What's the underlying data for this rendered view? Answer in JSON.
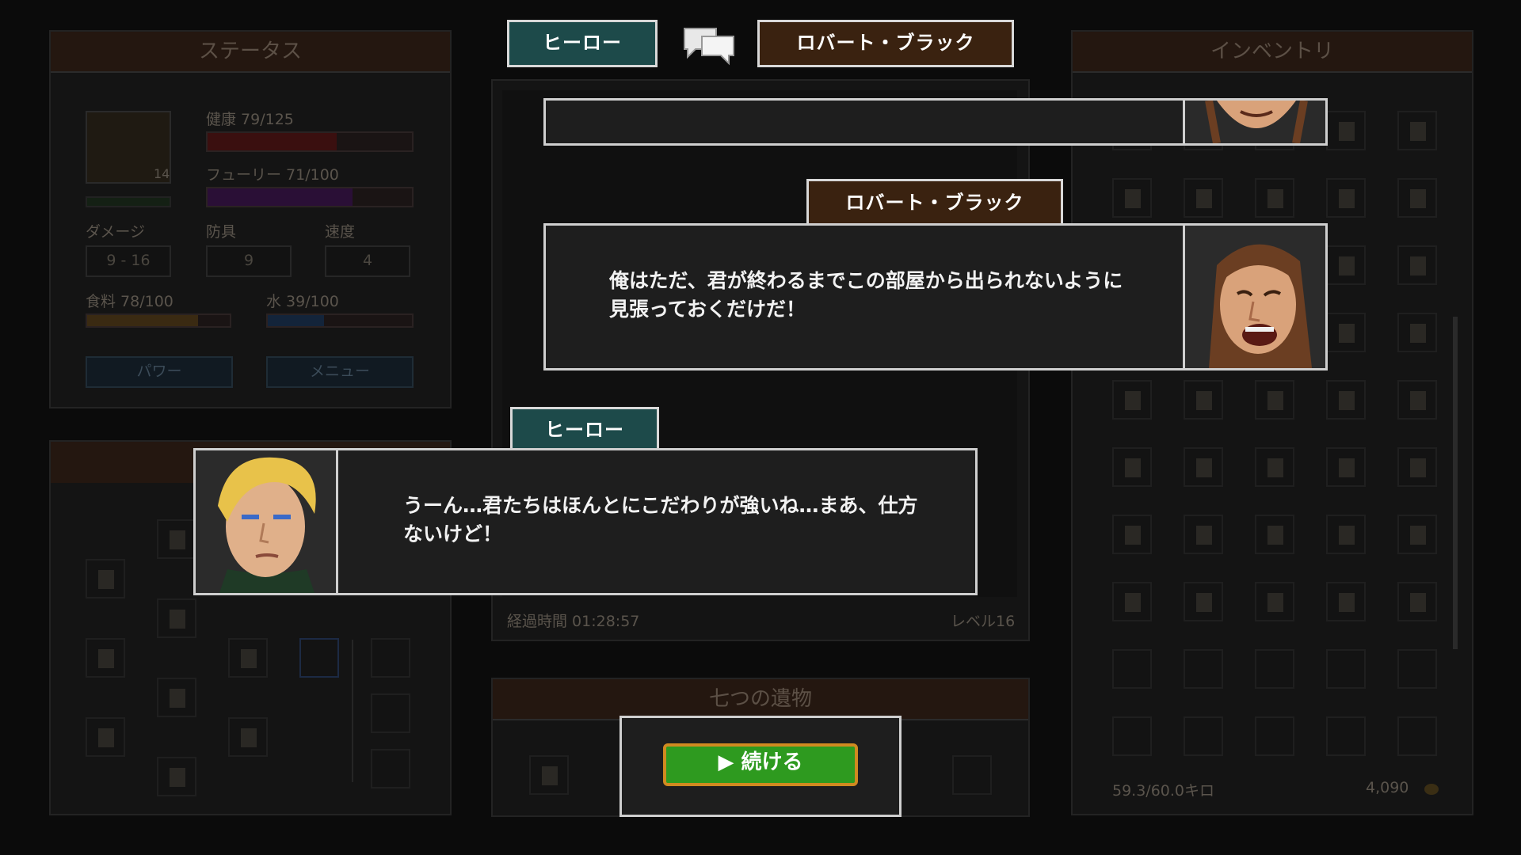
{
  "status_panel": {
    "title": "ステータス",
    "portrait_level": "14",
    "health": "健康 79/125",
    "fury": "フューリー 71/100",
    "damage_label": "ダメージ",
    "armor_label": "防具",
    "speed_label": "速度",
    "damage_value": "9 - 16",
    "armor_value": "9",
    "speed_value": "4",
    "food": "食料 78/100",
    "water": "水 39/100",
    "power_button": "パワー",
    "menu_button": "メニュー",
    "health_fill": 0.63,
    "fury_fill": 0.71,
    "food_fill": 0.78,
    "water_fill": 0.39
  },
  "center_panel": {
    "elapsed": "経過時間 01:28:57",
    "level": "レベル16",
    "relics_title": "七つの遺物"
  },
  "inventory_panel": {
    "title": "インベントリ",
    "weight": "59.3/60.0キロ",
    "gold": "4,090"
  },
  "dialogue": {
    "top_tag_left": "ヒーロー",
    "top_tag_right": "ロバート・ブラック",
    "robert": {
      "name": "ロバート・ブラック",
      "text": "俺はただ、君が終わるまでこの部屋から出られないように見張っておくだけだ！"
    },
    "hero": {
      "name": "ヒーロー",
      "text": "うーん…君たちはほんとにこだわりが強いね…まあ、仕方ないけど！"
    },
    "continue_label": "▶ 続ける"
  },
  "colors": {
    "tag_teal": "#1d4a4a",
    "tag_brown": "#3a2210",
    "continue_green": "#2e9a1f",
    "continue_border": "#d08a20"
  }
}
